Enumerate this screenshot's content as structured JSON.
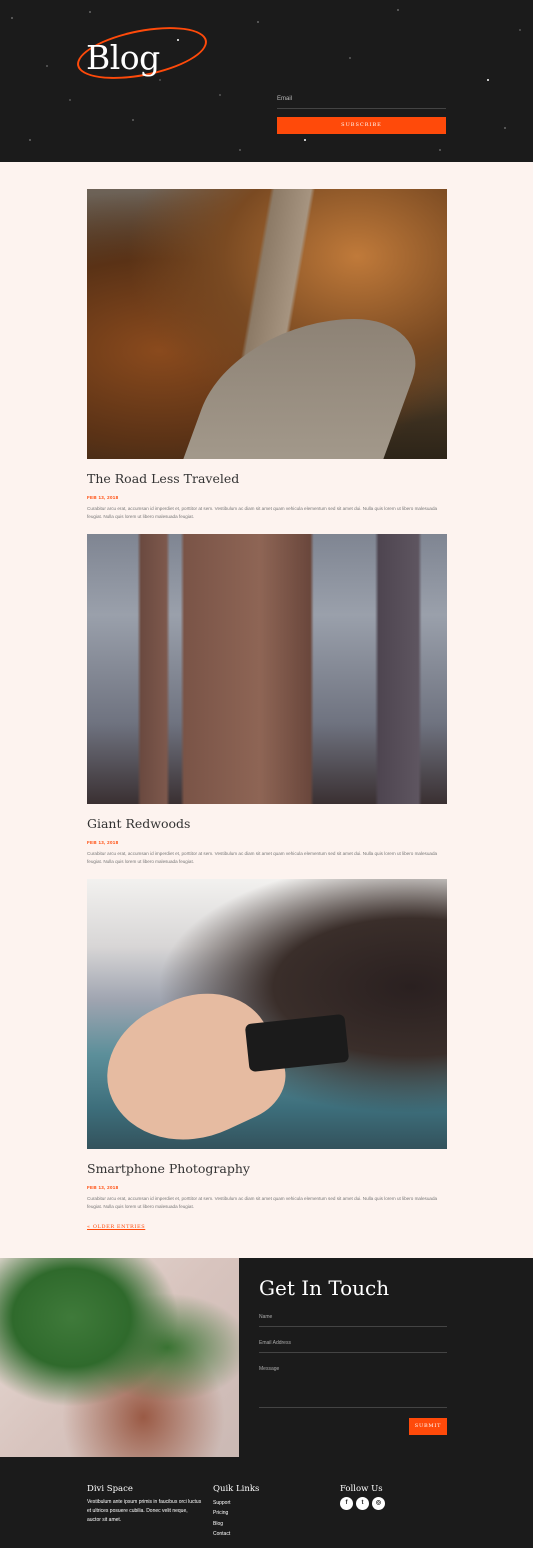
{
  "header": {
    "logo_text": "Blog",
    "email_label": "Email",
    "subscribe_label": "Subscribe"
  },
  "posts": [
    {
      "title": "The Road Less Traveled",
      "date": "FEB 13, 2018",
      "excerpt": "Curabitur arcu erat, accumsan id imperdiet et, porttitor at sem. Vestibulum ac diam sit amet quam vehicula elementum sed sit amet dui. Nulla quis lorem ut libero malesuada feugiat. Nulla quis lorem ut libero malesuada feugiat.",
      "image": "autumn-forest-road-photo"
    },
    {
      "title": "Giant Redwoods",
      "date": "FEB 13, 2018",
      "excerpt": "Curabitur arcu erat, accumsan id imperdiet et, porttitor at sem. Vestibulum ac diam sit amet quam vehicula elementum sed sit amet dui. Nulla quis lorem ut libero malesuada feugiat. Nulla quis lorem ut libero malesuada feugiat.",
      "image": "redwood-trees-photo"
    },
    {
      "title": "Smartphone Photography",
      "date": "FEB 13, 2018",
      "excerpt": "Curabitur arcu erat, accumsan id imperdiet et, porttitor at sem. Vestibulum ac diam sit amet quam vehicula elementum sed sit amet dui. Nulla quis lorem ut libero malesuada feugiat. Nulla quis lorem ut libero malesuada feugiat.",
      "image": "hands-smartphone-photo"
    }
  ],
  "pagination": {
    "older_label": "« OLDER ENTRIES"
  },
  "contact": {
    "title": "Get In Touch",
    "name_label": "Name",
    "email_label": "Email Address",
    "message_label": "Message",
    "submit_label": "Submit"
  },
  "footer": {
    "col1_title": "Divi Space",
    "col1_text": "Vestibulum ante ipsum primis in faucibus orci luctus et ultrices posuere cubilia. Donec velit neque, auctor sit amet.",
    "col2_title": "Quik Links",
    "links": [
      "Support",
      "Pricing",
      "Blog",
      "Contact"
    ],
    "col3_title": "Follow Us",
    "social": [
      {
        "icon": "facebook-icon",
        "glyph": "f"
      },
      {
        "icon": "twitter-icon",
        "glyph": "t"
      },
      {
        "icon": "instagram-icon",
        "glyph": "◎"
      }
    ]
  },
  "colors": {
    "accent": "#ff4a0a",
    "dark": "#1b1b1b",
    "page_bg": "#fdf3ef"
  }
}
